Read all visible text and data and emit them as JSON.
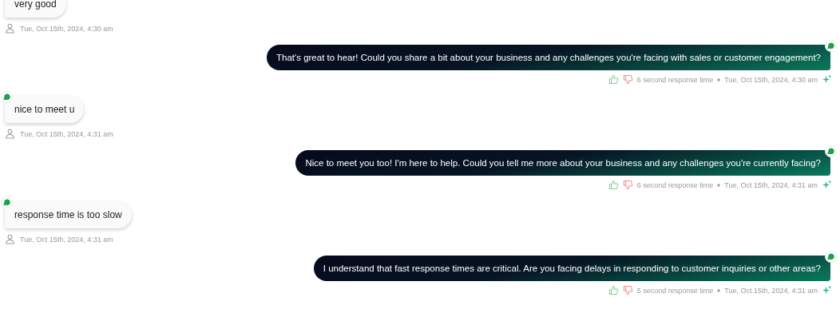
{
  "messages": [
    {
      "kind": "user",
      "badge": false,
      "text": "very good",
      "time": "Tue, Oct 15th, 2024, 4:30 am"
    },
    {
      "kind": "bot",
      "text": "That's great to hear! Could you share a bit about your business and any challenges you're facing with sales or customer engagement?",
      "response": "6 second response time",
      "time": "Tue, Oct 15th, 2024, 4:30 am"
    },
    {
      "kind": "user",
      "badge": true,
      "text": "nice to meet u",
      "time": "Tue, Oct 15th, 2024, 4:31 am"
    },
    {
      "kind": "bot",
      "text": "Nice to meet you too! I'm here to help. Could you tell me more about your business and any challenges you're currently facing?",
      "response": "6 second response time",
      "time": "Tue, Oct 15th, 2024, 4:31 am"
    },
    {
      "kind": "user",
      "badge": true,
      "text": "response time is too slow",
      "time": "Tue, Oct 15th, 2024, 4:31 am"
    },
    {
      "kind": "bot",
      "text": "I understand that fast response times are critical. Are you facing delays in responding to customer inquiries or other areas?",
      "response": "5 second response time",
      "time": "Tue, Oct 15th, 2024, 4:31 am"
    }
  ]
}
